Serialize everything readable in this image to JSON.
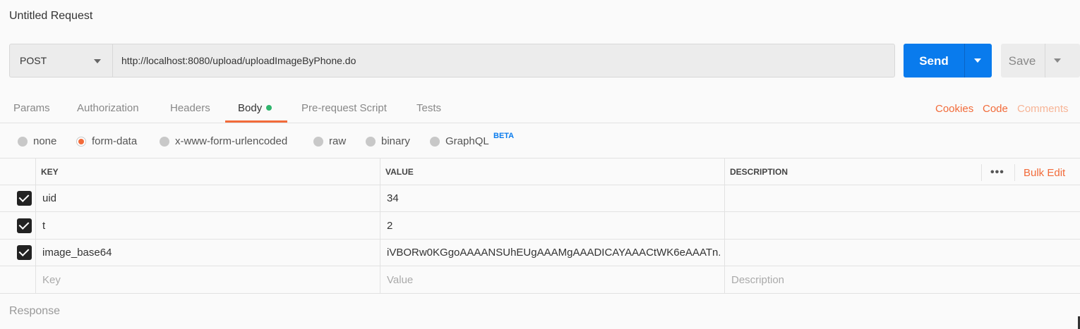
{
  "title": "Untitled Request",
  "request": {
    "method": "POST",
    "url": "http://localhost:8080/upload/uploadImageByPhone.do",
    "send_label": "Send",
    "save_label": "Save"
  },
  "tabs": [
    {
      "label": "Params"
    },
    {
      "label": "Authorization"
    },
    {
      "label": "Headers"
    },
    {
      "label": "Body"
    },
    {
      "label": "Pre-request Script"
    },
    {
      "label": "Tests"
    }
  ],
  "right_links": {
    "cookies": "Cookies",
    "code": "Code",
    "comments": "Comments"
  },
  "body_types": [
    {
      "label": "none"
    },
    {
      "label": "form-data"
    },
    {
      "label": "x-www-form-urlencoded"
    },
    {
      "label": "raw"
    },
    {
      "label": "binary"
    },
    {
      "label": "GraphQL"
    }
  ],
  "beta_badge": "BETA",
  "selected_body_type": "form-data",
  "table": {
    "headers": {
      "key": "KEY",
      "value": "VALUE",
      "description": "DESCRIPTION"
    },
    "bulk_edit": "Bulk Edit",
    "rows": [
      {
        "key": "uid",
        "value": "34",
        "description": "",
        "checked": true
      },
      {
        "key": "t",
        "value": "2",
        "description": "",
        "checked": true
      },
      {
        "key": "image_base64",
        "value": "iVBORw0KGgoAAAANSUhEUgAAAMgAAADICAYAAACtWK6eAAATn...",
        "description": "",
        "checked": true
      }
    ],
    "placeholders": {
      "key": "Key",
      "value": "Value",
      "description": "Description"
    }
  },
  "response_label": "Response",
  "colors": {
    "accent": "#f26b3a",
    "primary": "#097bed",
    "success": "#2fb56c"
  }
}
